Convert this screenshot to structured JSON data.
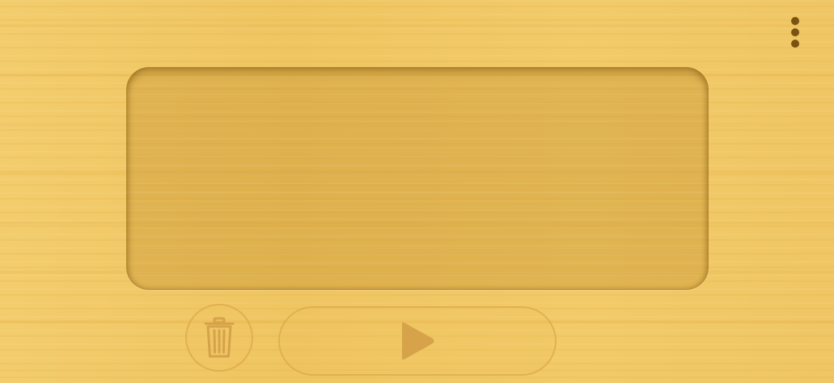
{
  "display": {
    "text": ""
  },
  "icons": {
    "menu": "more-vertical-icon",
    "delete": "trash-icon",
    "play": "play-icon"
  },
  "colors": {
    "wood_background": "#f1c865",
    "panel_inset": "#d9ab4e",
    "menu_dots": "#7a5212",
    "disabled_button_outline": "#d7a546",
    "disabled_icon": "#d6a24a"
  }
}
